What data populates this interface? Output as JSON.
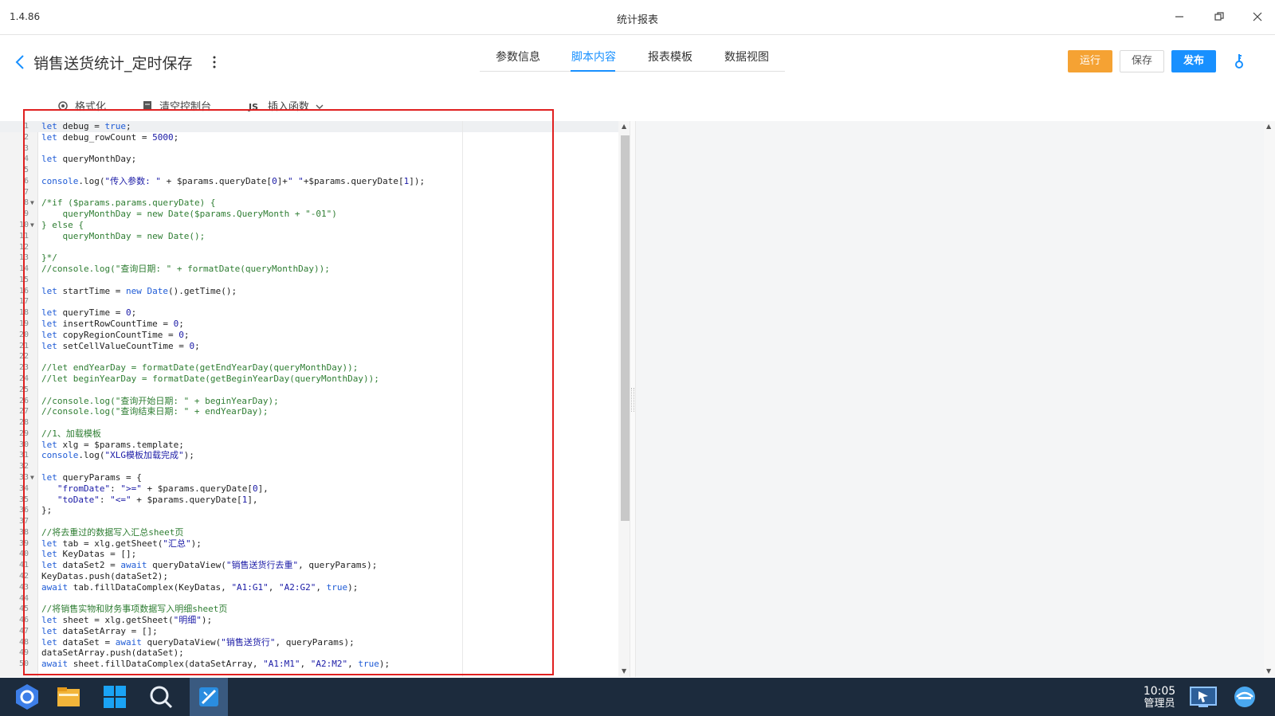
{
  "window": {
    "version": "1.4.86",
    "title": "统计报表"
  },
  "header": {
    "doc_title": "销售送货统计_定时保存",
    "tabs": [
      {
        "label": "参数信息",
        "active": false
      },
      {
        "label": "脚本内容",
        "active": true
      },
      {
        "label": "报表模板",
        "active": false
      },
      {
        "label": "数据视图",
        "active": false
      }
    ],
    "run_label": "运行",
    "save_label": "保存",
    "publish_label": "发布",
    "colors": {
      "run": "#f5a233",
      "publish": "#1890ff",
      "accent": "#1890ff"
    }
  },
  "toolbar": {
    "format_label": "格式化",
    "clear_console_label": "清空控制台",
    "insert_function_label": "插入函数"
  },
  "editor": {
    "lines": [
      {
        "n": "1",
        "fold": false,
        "code": [
          [
            "k",
            "let"
          ],
          [
            "t",
            " debug = "
          ],
          [
            "k",
            "true"
          ],
          [
            "t",
            ";"
          ]
        ]
      },
      {
        "n": "2",
        "fold": false,
        "code": [
          [
            "k",
            "let"
          ],
          [
            "t",
            " debug_rowCount = "
          ],
          [
            "n",
            "5000"
          ],
          [
            "t",
            ";"
          ]
        ]
      },
      {
        "n": "3",
        "fold": false,
        "code": []
      },
      {
        "n": "4",
        "fold": false,
        "code": [
          [
            "k",
            "let"
          ],
          [
            "t",
            " queryMonthDay;"
          ]
        ]
      },
      {
        "n": "5",
        "fold": false,
        "code": []
      },
      {
        "n": "6",
        "fold": false,
        "code": [
          [
            "k",
            "console"
          ],
          [
            "t",
            ".log("
          ],
          [
            "s",
            "\"传入参数: \""
          ],
          [
            "t",
            " + $params.queryDate["
          ],
          [
            "n",
            "0"
          ],
          [
            "t",
            "]+"
          ],
          [
            "s",
            "\" \""
          ],
          [
            "t",
            "+$params.queryDate["
          ],
          [
            "n",
            "1"
          ],
          [
            "t",
            "]);"
          ]
        ]
      },
      {
        "n": "7",
        "fold": false,
        "code": []
      },
      {
        "n": "8",
        "fold": true,
        "code": [
          [
            "c",
            "/*if ($params.params.queryDate) {"
          ]
        ]
      },
      {
        "n": "9",
        "fold": false,
        "code": [
          [
            "c",
            "    queryMonthDay = new Date($params.QueryMonth + \"-01\")"
          ]
        ]
      },
      {
        "n": "10",
        "fold": true,
        "code": [
          [
            "c",
            "} else {"
          ]
        ]
      },
      {
        "n": "11",
        "fold": false,
        "code": [
          [
            "c",
            "    queryMonthDay = new Date();"
          ]
        ]
      },
      {
        "n": "12",
        "fold": false,
        "code": []
      },
      {
        "n": "13",
        "fold": false,
        "code": [
          [
            "c",
            "}*/"
          ]
        ]
      },
      {
        "n": "14",
        "fold": false,
        "code": [
          [
            "c",
            "//console.log(\"查询日期: \" + formatDate(queryMonthDay));"
          ]
        ]
      },
      {
        "n": "15",
        "fold": false,
        "code": []
      },
      {
        "n": "16",
        "fold": false,
        "code": [
          [
            "k",
            "let"
          ],
          [
            "t",
            " startTime = "
          ],
          [
            "k",
            "new"
          ],
          [
            "t",
            " "
          ],
          [
            "k",
            "Date"
          ],
          [
            "t",
            "().getTime();"
          ]
        ]
      },
      {
        "n": "17",
        "fold": false,
        "code": []
      },
      {
        "n": "18",
        "fold": false,
        "code": [
          [
            "k",
            "let"
          ],
          [
            "t",
            " queryTime = "
          ],
          [
            "n",
            "0"
          ],
          [
            "t",
            ";"
          ]
        ]
      },
      {
        "n": "19",
        "fold": false,
        "code": [
          [
            "k",
            "let"
          ],
          [
            "t",
            " insertRowCountTime = "
          ],
          [
            "n",
            "0"
          ],
          [
            "t",
            ";"
          ]
        ]
      },
      {
        "n": "20",
        "fold": false,
        "code": [
          [
            "k",
            "let"
          ],
          [
            "t",
            " copyRegionCountTime = "
          ],
          [
            "n",
            "0"
          ],
          [
            "t",
            ";"
          ]
        ]
      },
      {
        "n": "21",
        "fold": false,
        "code": [
          [
            "k",
            "let"
          ],
          [
            "t",
            " setCellValueCountTime = "
          ],
          [
            "n",
            "0"
          ],
          [
            "t",
            ";"
          ]
        ]
      },
      {
        "n": "22",
        "fold": false,
        "code": []
      },
      {
        "n": "23",
        "fold": false,
        "code": [
          [
            "c",
            "//let endYearDay = formatDate(getEndYearDay(queryMonthDay));"
          ]
        ]
      },
      {
        "n": "24",
        "fold": false,
        "code": [
          [
            "c",
            "//let beginYearDay = formatDate(getBeginYearDay(queryMonthDay));"
          ]
        ]
      },
      {
        "n": "25",
        "fold": false,
        "code": []
      },
      {
        "n": "26",
        "fold": false,
        "code": [
          [
            "c",
            "//console.log(\"查询开始日期: \" + beginYearDay);"
          ]
        ]
      },
      {
        "n": "27",
        "fold": false,
        "code": [
          [
            "c",
            "//console.log(\"查询结束日期: \" + endYearDay);"
          ]
        ]
      },
      {
        "n": "28",
        "fold": false,
        "code": []
      },
      {
        "n": "29",
        "fold": false,
        "code": [
          [
            "c",
            "//1、加载模板"
          ]
        ]
      },
      {
        "n": "30",
        "fold": false,
        "code": [
          [
            "k",
            "let"
          ],
          [
            "t",
            " xlg = $params.template;"
          ]
        ]
      },
      {
        "n": "31",
        "fold": false,
        "code": [
          [
            "k",
            "console"
          ],
          [
            "t",
            ".log("
          ],
          [
            "s",
            "\"XLG模板加载完成\""
          ],
          [
            "t",
            ");"
          ]
        ]
      },
      {
        "n": "32",
        "fold": false,
        "code": []
      },
      {
        "n": "33",
        "fold": true,
        "code": [
          [
            "k",
            "let"
          ],
          [
            "t",
            " queryParams = {"
          ]
        ]
      },
      {
        "n": "34",
        "fold": false,
        "code": [
          [
            "t",
            "   "
          ],
          [
            "s",
            "\"fromDate\""
          ],
          [
            "t",
            ": "
          ],
          [
            "s",
            "\">=\""
          ],
          [
            "t",
            " + $params.queryDate["
          ],
          [
            "n",
            "0"
          ],
          [
            "t",
            "],"
          ]
        ]
      },
      {
        "n": "35",
        "fold": false,
        "code": [
          [
            "t",
            "   "
          ],
          [
            "s",
            "\"toDate\""
          ],
          [
            "t",
            ": "
          ],
          [
            "s",
            "\"<=\""
          ],
          [
            "t",
            " + $params.queryDate["
          ],
          [
            "n",
            "1"
          ],
          [
            "t",
            "],"
          ]
        ]
      },
      {
        "n": "36",
        "fold": false,
        "code": [
          [
            "t",
            "};"
          ]
        ]
      },
      {
        "n": "37",
        "fold": false,
        "code": []
      },
      {
        "n": "38",
        "fold": false,
        "code": [
          [
            "c",
            "//将去重过的数据写入汇总sheet页"
          ]
        ]
      },
      {
        "n": "39",
        "fold": false,
        "code": [
          [
            "k",
            "let"
          ],
          [
            "t",
            " tab = xlg.getSheet("
          ],
          [
            "s",
            "\"汇总\""
          ],
          [
            "t",
            ");"
          ]
        ]
      },
      {
        "n": "40",
        "fold": false,
        "code": [
          [
            "k",
            "let"
          ],
          [
            "t",
            " KeyDatas = [];"
          ]
        ]
      },
      {
        "n": "41",
        "fold": false,
        "code": [
          [
            "k",
            "let"
          ],
          [
            "t",
            " dataSet2 = "
          ],
          [
            "k",
            "await"
          ],
          [
            "t",
            " queryDataView("
          ],
          [
            "s",
            "\"销售送货行去重\""
          ],
          [
            "t",
            ", queryParams);"
          ]
        ]
      },
      {
        "n": "42",
        "fold": false,
        "code": [
          [
            "t",
            "KeyDatas.push(dataSet2);"
          ]
        ]
      },
      {
        "n": "43",
        "fold": false,
        "code": [
          [
            "k",
            "await"
          ],
          [
            "t",
            " tab.fillDataComplex(KeyDatas, "
          ],
          [
            "s",
            "\"A1:G1\""
          ],
          [
            "t",
            ", "
          ],
          [
            "s",
            "\"A2:G2\""
          ],
          [
            "t",
            ", "
          ],
          [
            "k",
            "true"
          ],
          [
            "t",
            ");"
          ]
        ]
      },
      {
        "n": "44",
        "fold": false,
        "code": []
      },
      {
        "n": "45",
        "fold": false,
        "code": [
          [
            "c",
            "//将销售实物和财务事项数据写入明细sheet页"
          ]
        ]
      },
      {
        "n": "46",
        "fold": false,
        "code": [
          [
            "k",
            "let"
          ],
          [
            "t",
            " sheet = xlg.getSheet("
          ],
          [
            "s",
            "\"明细\""
          ],
          [
            "t",
            ");"
          ]
        ]
      },
      {
        "n": "47",
        "fold": false,
        "code": [
          [
            "k",
            "let"
          ],
          [
            "t",
            " dataSetArray = [];"
          ]
        ]
      },
      {
        "n": "48",
        "fold": false,
        "code": [
          [
            "k",
            "let"
          ],
          [
            "t",
            " dataSet = "
          ],
          [
            "k",
            "await"
          ],
          [
            "t",
            " queryDataView("
          ],
          [
            "s",
            "\"销售送货行\""
          ],
          [
            "t",
            ", queryParams);"
          ]
        ]
      },
      {
        "n": "49",
        "fold": false,
        "code": [
          [
            "t",
            "dataSetArray.push(dataSet);"
          ]
        ]
      },
      {
        "n": "50",
        "fold": false,
        "code": [
          [
            "k",
            "await"
          ],
          [
            "t",
            " sheet.fillDataComplex(dataSetArray, "
          ],
          [
            "s",
            "\"A1:M1\""
          ],
          [
            "t",
            ", "
          ],
          [
            "s",
            "\"A2:M2\""
          ],
          [
            "t",
            ", "
          ],
          [
            "k",
            "true"
          ],
          [
            "t",
            ");"
          ]
        ]
      }
    ]
  },
  "taskbar": {
    "time": "10:05",
    "user": "管理员"
  }
}
